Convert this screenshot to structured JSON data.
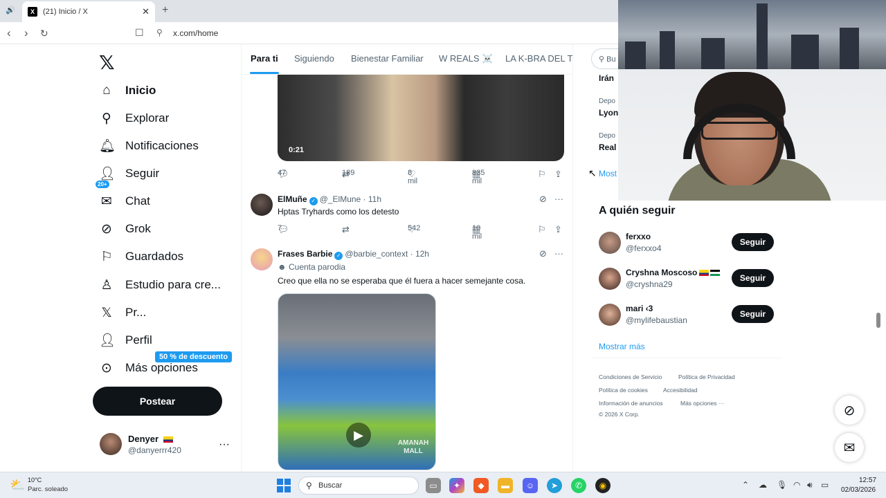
{
  "browser": {
    "tab_title": "(21) Inicio / X",
    "tab_favicon": "X",
    "url": "x.com/home"
  },
  "sidebar": {
    "items": [
      {
        "label": "Inicio",
        "icon": "home-icon"
      },
      {
        "label": "Explorar",
        "icon": "search-icon"
      },
      {
        "label": "Notificaciones",
        "icon": "bell-icon"
      },
      {
        "label": "Seguir",
        "icon": "person-add-icon"
      },
      {
        "label": "Chat",
        "icon": "mail-icon"
      },
      {
        "label": "Grok",
        "icon": "grok-icon"
      },
      {
        "label": "Guardados",
        "icon": "bookmark-icon"
      },
      {
        "label": "Estudio para cre...",
        "icon": "creator-studio-icon"
      },
      {
        "label": "Pr...",
        "icon": "x-premium-icon"
      },
      {
        "label": "Perfil",
        "icon": "person-icon"
      },
      {
        "label": "Más opciones",
        "icon": "more-circle-icon"
      }
    ],
    "notifications_badge": "20+",
    "premium_badge": "50 % de descuento",
    "post_button": "Postear",
    "account": {
      "name": "Denyer",
      "handle": "@danyerrr420"
    }
  },
  "feed": {
    "tabs": [
      "Para ti",
      "Siguiendo",
      "Bienestar Familiar",
      "W REALS ☠️",
      "LA K-BRA DEL TR"
    ],
    "video1": {
      "duration": "0:21",
      "replies": "47",
      "reposts": "189",
      "likes": "8 mil",
      "views": "835 mil"
    },
    "tweet1": {
      "name": "ElMuñe",
      "handle_time": "@_ElMune · 11h",
      "text": "Hptas Tryhards como los detesto",
      "replies": "7",
      "reposts": "",
      "likes": "542",
      "views": "10 mil"
    },
    "tweet2": {
      "name": "Frases Barbie",
      "handle_time": "@barbie_context · 12h",
      "parody": "Cuenta parodia",
      "text": "Creo que ella no se esperaba que él fuera a hacer semejante cosa.",
      "watermark": "AMANAH MALL"
    }
  },
  "right": {
    "search_placeholder": "Bu",
    "trends": [
      {
        "category": "",
        "name": "Irán"
      },
      {
        "category": "Depo",
        "name": "Lyon"
      },
      {
        "category": "Depo",
        "name": "Real"
      }
    ],
    "show_more_partial": "Most",
    "follow_title": "A quién seguir",
    "follow": [
      {
        "name": "ferxxo",
        "handle": "@ferxxo4",
        "button": "Seguir"
      },
      {
        "name": "Cryshna Moscoso",
        "handle": "@cryshna29",
        "button": "Seguir"
      },
      {
        "name": "mari ‹3",
        "handle": "@mylifebaustian",
        "button": "Seguir"
      }
    ],
    "show_more": "Mostrar más",
    "footer": {
      "row1": [
        "Condiciones de Servicio",
        "Política de Privacidad"
      ],
      "row2": [
        "Política de cookies",
        "Accesibilidad"
      ],
      "row3": [
        "Información de anuncios",
        "Más opciones ···"
      ],
      "copyright": "© 2026 X Corp."
    }
  },
  "taskbar": {
    "weather_temp": "10°C",
    "weather_desc": "Parc. soleado",
    "search_label": "Buscar",
    "time": "12:57",
    "date": "02/03/2026"
  },
  "colors": {
    "accent": "#1d9bf0",
    "text": "#0f1419",
    "muted": "#536471"
  }
}
